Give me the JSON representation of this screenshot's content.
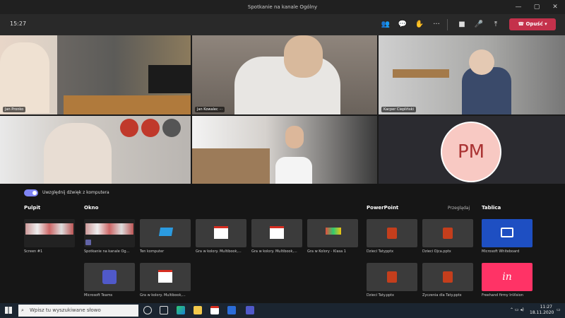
{
  "window": {
    "title": "Spotkanie na kanale Ogólny"
  },
  "toolbar": {
    "timer": "15:27",
    "leave_label": "Opuść"
  },
  "participants": [
    {
      "name": "Jan Pronko"
    },
    {
      "name": "Jan Kowalec"
    },
    {
      "name": "Kacper Ciepliński"
    }
  ],
  "avatar": {
    "initials": "PM"
  },
  "share": {
    "audio_label": "Uwzględnij dźwięk z komputera",
    "sections": {
      "desktop": "Pulpit",
      "window": "Okno",
      "powerpoint": "PowerPoint",
      "whiteboard": "Tablica"
    },
    "browse_label": "Przeglądaj",
    "desktop_items": [
      {
        "label": "Screen #1"
      }
    ],
    "window_items": [
      {
        "label": "Spotkanie na kanale Og..."
      },
      {
        "label": "Ten komputer"
      },
      {
        "label": "Gra w kolory. Multibook,..."
      },
      {
        "label": "Gra w kolory. Multibook,..."
      },
      {
        "label": "Gra w Kolory - Klasa 1"
      },
      {
        "label": "Microsoft Teams"
      },
      {
        "label": "Gra w kolory. Multibook,..."
      }
    ],
    "powerpoint_items": [
      {
        "label": "Dzieci Tatypptx"
      },
      {
        "label": "Dzieci Ojca.pptx"
      },
      {
        "label": "Dzieci Taty.pptx"
      },
      {
        "label": "Życzenia dla Taty.pptx"
      }
    ],
    "whiteboard_items": [
      {
        "label": "Microsoft Whiteboard"
      },
      {
        "label": "Freehand firmy InVision"
      }
    ]
  },
  "taskbar": {
    "search_placeholder": "Wpisz tu wyszukiwane słowo",
    "time": "11:27",
    "date": "18.11.2020"
  },
  "colors": {
    "leave": "#c4314b",
    "accent": "#7f85f5",
    "whiteboard": "#1e4fc2",
    "invision": "#ff3366",
    "pp": "#c43e1c"
  }
}
